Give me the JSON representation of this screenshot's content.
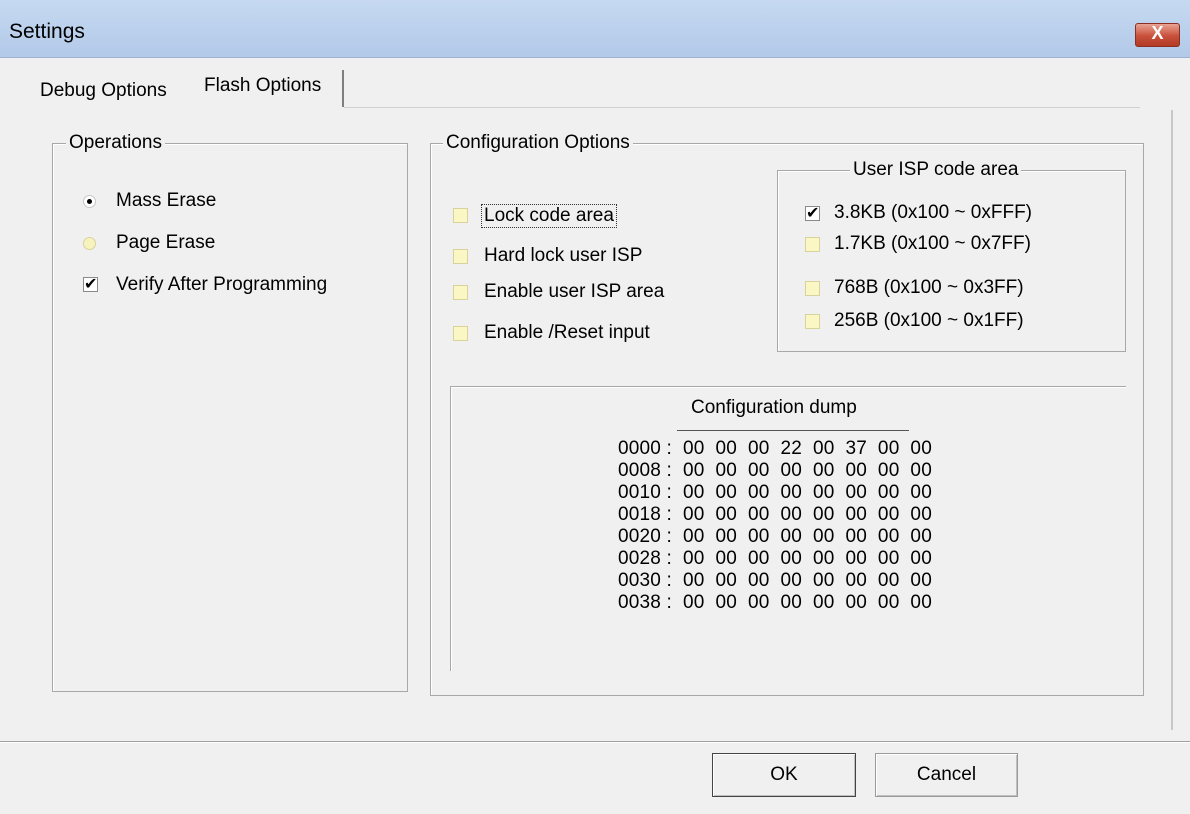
{
  "window": {
    "title": "Settings",
    "close_label": "X"
  },
  "tabs": [
    {
      "label": "Debug Options",
      "selected": false
    },
    {
      "label": "Flash Options",
      "selected": true
    }
  ],
  "operations": {
    "legend": "Operations",
    "mass_erase": {
      "label": "Mass Erase",
      "selected": true
    },
    "page_erase": {
      "label": "Page Erase",
      "selected": false
    },
    "verify": {
      "label": "Verify After Programming",
      "checked": true
    }
  },
  "config": {
    "legend": "Configuration Options",
    "options": [
      {
        "label": "Lock code area",
        "checked": false
      },
      {
        "label": "Hard lock user ISP",
        "checked": false
      },
      {
        "label": "Enable user ISP area",
        "checked": false
      },
      {
        "label": "Enable /Reset input",
        "checked": false
      }
    ],
    "isp": {
      "legend": "User ISP code area",
      "options": [
        {
          "label": "3.8KB (0x100 ~ 0xFFF)",
          "checked": true
        },
        {
          "label": "1.7KB (0x100 ~ 0x7FF)",
          "checked": false
        },
        {
          "label": "768B (0x100 ~ 0x3FF)",
          "checked": false
        },
        {
          "label": "256B (0x100 ~ 0x1FF)",
          "checked": false
        }
      ]
    },
    "dump": {
      "title": "Configuration dump",
      "rows": [
        "0000 :  00  00  00  22  00  37  00  00",
        "0008 :  00  00  00  00  00  00  00  00",
        "0010 :  00  00  00  00  00  00  00  00",
        "0018 :  00  00  00  00  00  00  00  00",
        "0020 :  00  00  00  00  00  00  00  00",
        "0028 :  00  00  00  00  00  00  00  00",
        "0030 :  00  00  00  00  00  00  00  00",
        "0038 :  00  00  00  00  00  00  00  00"
      ]
    }
  },
  "buttons": {
    "ok": "OK",
    "cancel": "Cancel"
  }
}
